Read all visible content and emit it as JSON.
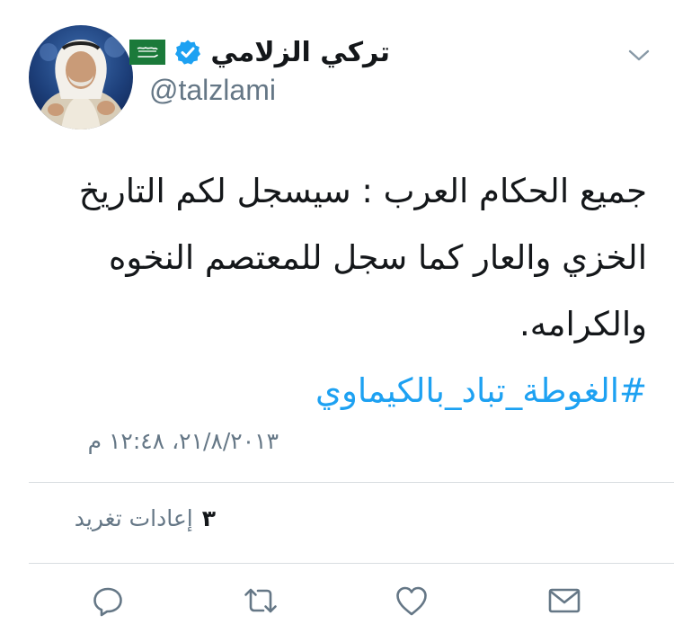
{
  "user": {
    "display_name": "تركي الزلامي",
    "handle": "@talzlami",
    "verified": true,
    "flag": "saudi-arabia-flag-icon"
  },
  "tweet": {
    "lines": [
      "جميع الحكام العرب : سيسجل لكم التاريخ",
      "الخزي والعار كما سجل للمعتصم النخوه",
      "والكرامه."
    ],
    "hashtag": "#الغوطة_تباد_بالكيماوي",
    "timestamp": "٢١/٨/٢٠١٣، ١٢:٤٨ م"
  },
  "stats": {
    "retweets_count": "٣",
    "retweets_label": "إعادات تغريد"
  },
  "actions": [
    "reply-icon",
    "retweet-icon",
    "like-icon",
    "share-icon"
  ],
  "colors": {
    "accent": "#1da1f2",
    "verified": "#1da1f2",
    "muted": "#657786",
    "icon": "#657786",
    "text": "#14171a",
    "divider": "#d9dde1"
  }
}
